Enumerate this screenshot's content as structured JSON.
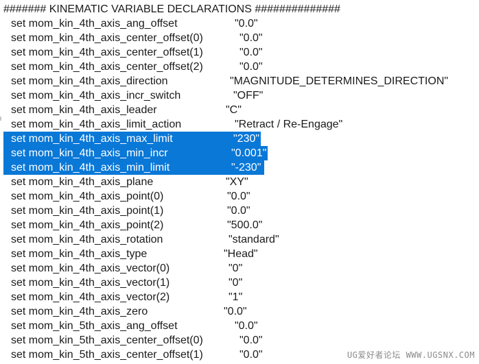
{
  "header": "####### KINEMATIC VARIABLE DECLARATIONS ##############",
  "lines": [
    {
      "cmd": "set",
      "name": "mom_kin_4th_axis_ang_offset",
      "value": "\"0.0\"",
      "selected": false
    },
    {
      "cmd": "set",
      "name": "mom_kin_4th_axis_center_offset(0)",
      "value": "\"0.0\"",
      "selected": false
    },
    {
      "cmd": "set",
      "name": "mom_kin_4th_axis_center_offset(1)",
      "value": "\"0.0\"",
      "selected": false
    },
    {
      "cmd": "set",
      "name": "mom_kin_4th_axis_center_offset(2)",
      "value": "\"0.0\"",
      "selected": false
    },
    {
      "cmd": "set",
      "name": "mom_kin_4th_axis_direction",
      "value": "\"MAGNITUDE_DETERMINES_DIRECTION\"",
      "selected": false
    },
    {
      "cmd": "set",
      "name": "mom_kin_4th_axis_incr_switch",
      "value": "\"OFF\"",
      "selected": false
    },
    {
      "cmd": "set",
      "name": "mom_kin_4th_axis_leader",
      "value": "\"C\"",
      "selected": false
    },
    {
      "cmd": "set",
      "name": "mom_kin_4th_axis_limit_action",
      "value": "\"Retract / Re-Engage\"",
      "selected": false
    },
    {
      "cmd": "set",
      "name": "mom_kin_4th_axis_max_limit",
      "value": "\"230\"",
      "selected": true
    },
    {
      "cmd": "set",
      "name": "mom_kin_4th_axis_min_incr",
      "value": "\"0.001\"",
      "selected": true
    },
    {
      "cmd": "set",
      "name": "mom_kin_4th_axis_min_limit",
      "value": "\"-230\"",
      "selected": true
    },
    {
      "cmd": "set",
      "name": "mom_kin_4th_axis_plane",
      "value": "\"XY\"",
      "selected": false
    },
    {
      "cmd": "set",
      "name": "mom_kin_4th_axis_point(0)",
      "value": "\"0.0\"",
      "selected": false
    },
    {
      "cmd": "set",
      "name": "mom_kin_4th_axis_point(1)",
      "value": "\"0.0\"",
      "selected": false
    },
    {
      "cmd": "set",
      "name": "mom_kin_4th_axis_point(2)",
      "value": "\"500.0\"",
      "selected": false
    },
    {
      "cmd": "set",
      "name": "mom_kin_4th_axis_rotation",
      "value": "\"standard\"",
      "selected": false
    },
    {
      "cmd": "set",
      "name": "mom_kin_4th_axis_type",
      "value": "\"Head\"",
      "selected": false
    },
    {
      "cmd": "set",
      "name": "mom_kin_4th_axis_vector(0)",
      "value": "\"0\"",
      "selected": false
    },
    {
      "cmd": "set",
      "name": "mom_kin_4th_axis_vector(1)",
      "value": "\"0\"",
      "selected": false
    },
    {
      "cmd": "set",
      "name": "mom_kin_4th_axis_vector(2)",
      "value": "\"1\"",
      "selected": false
    },
    {
      "cmd": "set",
      "name": "mom_kin_4th_axis_zero",
      "value": "\"0.0\"",
      "selected": false
    },
    {
      "cmd": "set",
      "name": "mom_kin_5th_axis_ang_offset",
      "value": "\"0.0\"",
      "selected": false
    },
    {
      "cmd": "set",
      "name": "mom_kin_5th_axis_center_offset(0)",
      "value": "\"0.0\"",
      "selected": false
    },
    {
      "cmd": "set",
      "name": "mom_kin_5th_axis_center_offset(1)",
      "value": "\"0.0\"",
      "selected": false
    }
  ],
  "watermark": "UG爱好者论坛 WWW.UGSNX.COM",
  "colors": {
    "selection": "#0a78d7",
    "text": "#1a1a1a",
    "selected_text": "#ffffff",
    "watermark": "#8a8a8a"
  }
}
